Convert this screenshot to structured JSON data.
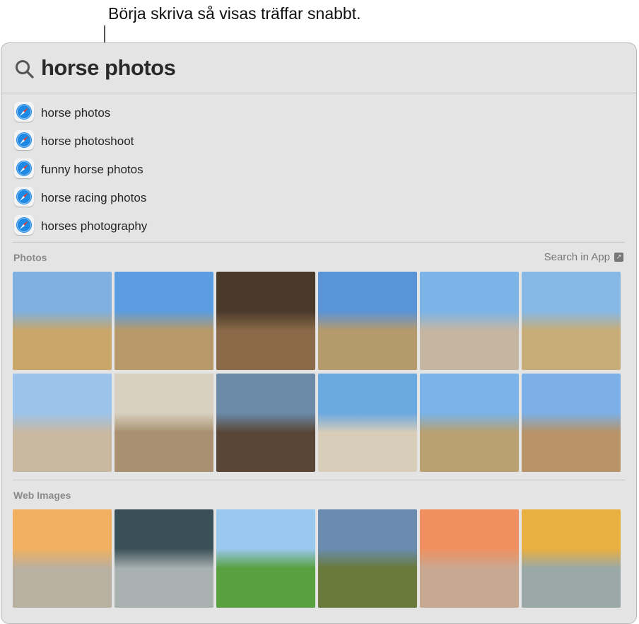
{
  "callout": "Börja skriva så visas träffar snabbt.",
  "search": {
    "query": "horse photos",
    "icon": "magnifying-glass-icon"
  },
  "suggestions": [
    {
      "label": "horse photos",
      "icon": "safari-icon"
    },
    {
      "label": "horse photoshoot",
      "icon": "safari-icon"
    },
    {
      "label": "funny horse photos",
      "icon": "safari-icon"
    },
    {
      "label": "horse racing photos",
      "icon": "safari-icon"
    },
    {
      "label": "horses photography",
      "icon": "safari-icon"
    }
  ],
  "photos": {
    "title": "Photos",
    "search_in_app": "Search in App"
  },
  "web_images": {
    "title": "Web Images"
  },
  "colors": {
    "panel": "#e4e4e4",
    "accent": "#1e88e5"
  }
}
